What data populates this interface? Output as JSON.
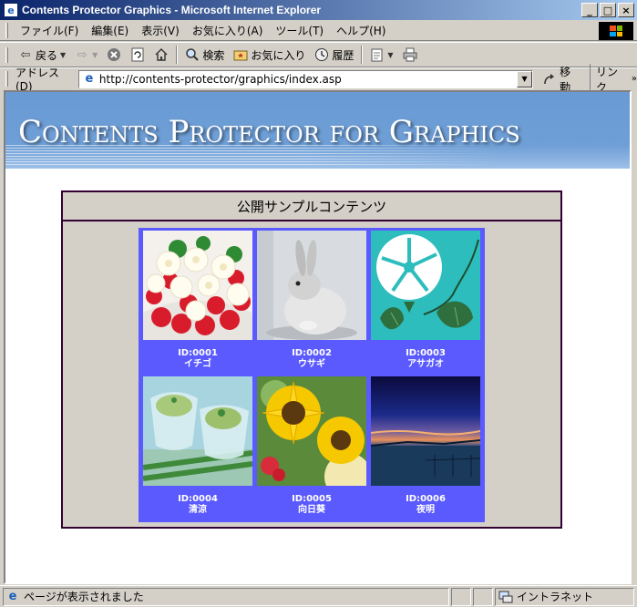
{
  "window": {
    "title": "Contents Protector Graphics - Microsoft Internet Explorer",
    "minimize": "_",
    "maximize": "□",
    "close": "×"
  },
  "menu": [
    "ファイル(F)",
    "編集(E)",
    "表示(V)",
    "お気に入り(A)",
    "ツール(T)",
    "ヘルプ(H)"
  ],
  "toolbar": {
    "back": "戻る",
    "search": "検索",
    "favorites": "お気に入り",
    "history": "履歴"
  },
  "address": {
    "label": "アドレス(D)",
    "url": "http://contents-protector/graphics/index.asp",
    "go": "移動",
    "links": "リンク"
  },
  "banner": {
    "title": "Contents Protector for Graphics"
  },
  "panel": {
    "title": "公開サンプルコンテンツ",
    "items": [
      {
        "id": "ID:0001",
        "name": "イチゴ"
      },
      {
        "id": "ID:0002",
        "name": "ウサギ"
      },
      {
        "id": "ID:0003",
        "name": "アサガオ"
      },
      {
        "id": "ID:0004",
        "name": "清涼"
      },
      {
        "id": "ID:0005",
        "name": "向日葵"
      },
      {
        "id": "ID:0006",
        "name": "夜明"
      }
    ]
  },
  "status": {
    "text": "ページが表示されました",
    "zone": "イントラネット"
  },
  "colors": {
    "grid_bg": "#5a5aff",
    "panel_border": "#330033",
    "banner": "#6a9ad4"
  }
}
